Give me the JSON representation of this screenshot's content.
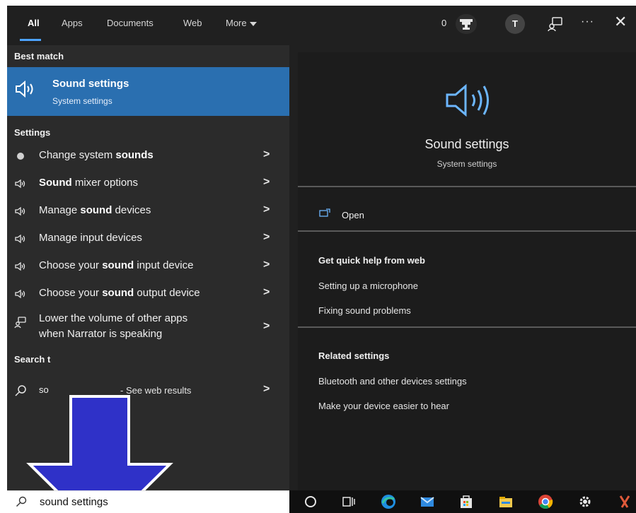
{
  "tabs": [
    {
      "label": "All",
      "active": true
    },
    {
      "label": "Apps",
      "active": false
    },
    {
      "label": "Documents",
      "active": false
    },
    {
      "label": "Web",
      "active": false
    },
    {
      "label": "More",
      "active": false
    }
  ],
  "header": {
    "points": "0",
    "avatar_initial": "T"
  },
  "best_match": {
    "heading": "Best match",
    "title": "Sound settings",
    "subtitle": "System settings",
    "icon": "speaker-icon"
  },
  "settings": {
    "heading": "Settings",
    "items": [
      {
        "pre": "Change system ",
        "bold": "sounds",
        "post": "",
        "icon": "sound-dot-icon"
      },
      {
        "pre": "",
        "bold": "Sound",
        "post": " mixer options",
        "icon": "speaker-icon"
      },
      {
        "pre": "Manage ",
        "bold": "sound",
        "post": " devices",
        "icon": "speaker-icon"
      },
      {
        "pre": "Manage input devices",
        "bold": "",
        "post": "",
        "icon": "speaker-icon"
      },
      {
        "pre": "Choose your ",
        "bold": "sound",
        "post": " input device",
        "icon": "speaker-icon"
      },
      {
        "pre": "Choose your ",
        "bold": "sound",
        "post": " output device",
        "icon": "speaker-icon"
      },
      {
        "line1": "Lower the volume of other apps",
        "line2": "when Narrator is speaking",
        "icon": "narrator-icon"
      }
    ]
  },
  "search_web": {
    "heading": "Search t",
    "query_fragment": "so",
    "tail": "- See web results"
  },
  "search_box": {
    "value": "sound settings"
  },
  "detail": {
    "title": "Sound settings",
    "subtitle": "System settings",
    "open_label": "Open",
    "quick_help_heading": "Get quick help from web",
    "quick_help_links": [
      "Setting up a microphone",
      "Fixing sound problems"
    ],
    "related_heading": "Related settings",
    "related_links": [
      "Bluetooth and other devices settings",
      "Make your device easier to hear"
    ]
  },
  "colors": {
    "accent": "#2a6fb0",
    "icon_blue": "#6cb6ff",
    "arrow": "#2f31c8"
  }
}
